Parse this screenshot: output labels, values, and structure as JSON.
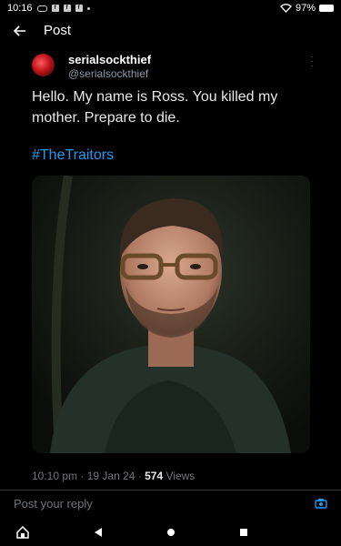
{
  "status_bar": {
    "time": "10:16",
    "battery": "97%"
  },
  "header": {
    "title": "Post"
  },
  "tweet": {
    "display_name": "serialsockthief",
    "handle": "@serialsockthief",
    "text": "Hello. My name is Ross. You killed my mother. Prepare to die.",
    "hashtag": "#TheTraitors",
    "time": "10:10 pm",
    "date": "19 Jan 24",
    "views_count": "574",
    "views_label": "Views"
  },
  "reply": {
    "placeholder": "Post your reply"
  },
  "colors": {
    "accent": "#1d9bf0",
    "background": "#000000",
    "secondary_text": "#71767b"
  }
}
